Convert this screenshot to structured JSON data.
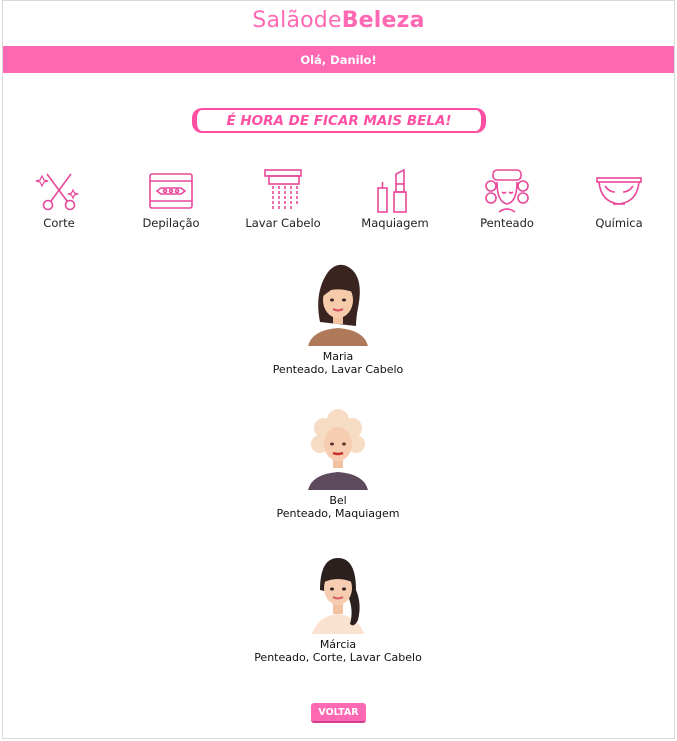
{
  "brand": {
    "part1": "Salãode",
    "part2": "Beleza"
  },
  "header": {
    "greeting": "Olá, Danilo!"
  },
  "slogan": "É HORA DE FICAR MAIS BELA!",
  "colors": {
    "accent": "#ff69b4",
    "accent_dark": "#ff4fa3"
  },
  "services": [
    {
      "label": "Corte",
      "icon": "scissors-icon"
    },
    {
      "label": "Depilação",
      "icon": "razor-blade-icon"
    },
    {
      "label": "Lavar Cabelo",
      "icon": "shower-icon"
    },
    {
      "label": "Maquiagem",
      "icon": "lipstick-icon"
    },
    {
      "label": "Penteado",
      "icon": "hair-rollers-icon"
    },
    {
      "label": "Química",
      "icon": "bowl-icon"
    }
  ],
  "professionals": [
    {
      "name": "Maria",
      "services": "Penteado, Lavar Cabelo",
      "avatar": "woman-dark-hair-avatar"
    },
    {
      "name": "Bel",
      "services": "Penteado, Maquiagem",
      "avatar": "woman-blonde-hair-avatar"
    },
    {
      "name": "Márcia",
      "services": "Penteado, Corte, Lavar Cabelo",
      "avatar": "woman-bangs-avatar"
    }
  ],
  "back_button": "VOLTAR"
}
